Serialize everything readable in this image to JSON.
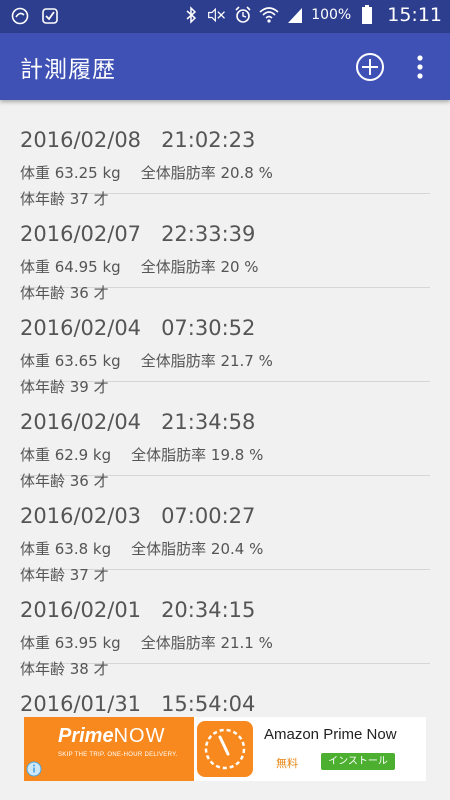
{
  "status_bar": {
    "battery_pct": "100%",
    "time": "15:11",
    "icons": [
      "sync-icon",
      "checkbox-icon",
      "bluetooth-icon",
      "mute-icon",
      "alarm-icon",
      "wifi-icon",
      "signal-icon",
      "battery-icon"
    ]
  },
  "app_bar": {
    "title": "計測履歴",
    "add_icon": "add-circle-icon",
    "more_icon": "more-vert-icon"
  },
  "records": [
    {
      "datetime": "2016/02/08   21:02:23",
      "weight": "体重 63.25 kg",
      "fat": "全体脂肪率 20.8 %",
      "age": "体年齢 37 才"
    },
    {
      "datetime": "2016/02/07   22:33:39",
      "weight": "体重 64.95 kg",
      "fat": "全体脂肪率 20 %",
      "age": "体年齢 36 才"
    },
    {
      "datetime": "2016/02/04   07:30:52",
      "weight": "体重 63.65 kg",
      "fat": "全体脂肪率 21.7 %",
      "age": "体年齢 39 才"
    },
    {
      "datetime": "2016/02/04   21:34:58",
      "weight": "体重 62.9 kg",
      "fat": "全体脂肪率 19.8 %",
      "age": "体年齢 36 才"
    },
    {
      "datetime": "2016/02/03   07:00:27",
      "weight": "体重 63.8 kg",
      "fat": "全体脂肪率 20.4 %",
      "age": "体年齢 37 才"
    },
    {
      "datetime": "2016/02/01   20:34:15",
      "weight": "体重 63.95 kg",
      "fat": "全体脂肪率 21.1 %",
      "age": "体年齢 38 才"
    },
    {
      "datetime": "2016/01/31   15:54:04",
      "weight": "",
      "fat": "",
      "age": ""
    }
  ],
  "ad": {
    "logo_prime": "Prime",
    "logo_now": "NOW",
    "tagline": "SKIP THE TRIP. ONE-HOUR DELIVERY.",
    "app_name": "Amazon Prime Now",
    "price": "無料",
    "install_label": "インストール",
    "brand_color": "#f7891f",
    "install_color": "#4caf2f"
  }
}
